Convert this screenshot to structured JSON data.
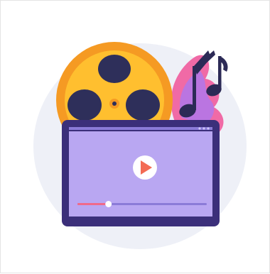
{
  "scene": {
    "description_icons": [
      "film-reel-icon",
      "music-notes-icon",
      "video-player-icon",
      "play-icon"
    ],
    "colors": {
      "background_blob": "#eef0f7",
      "reel_orange": "#f59a23",
      "reel_yellow": "#ffbf2f",
      "reel_dark": "#2e2f5a",
      "notes_navy": "#2c2a56",
      "smoke_pink": "#f06aa6",
      "smoke_violet": "#b477e8",
      "player_frame": "#3b2f7a",
      "player_screen": "#b9a7f2",
      "play_button": "#ffffff",
      "play_triangle": "#f36b54",
      "progress_played": "#f06a8a",
      "progress_track": "#8b7bd8"
    },
    "player": {
      "progress_fraction": 0.24
    }
  }
}
